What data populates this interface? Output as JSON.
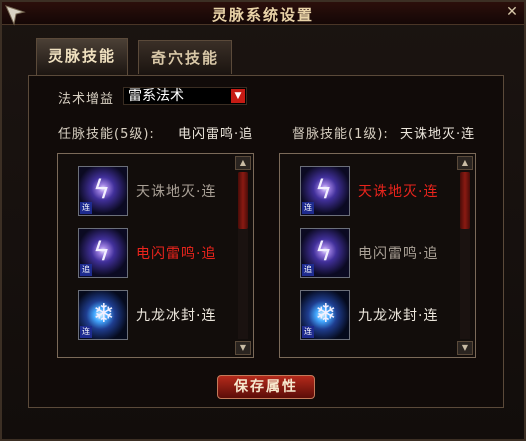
{
  "window": {
    "title": "灵脉系统设置",
    "close_icon": "close-icon"
  },
  "tabs": [
    {
      "label": "灵脉技能",
      "active": true
    },
    {
      "label": "奇穴技能",
      "active": false
    }
  ],
  "spell_boost": {
    "label": "法术增益",
    "selected": "雷系法术"
  },
  "ren_meridian": {
    "label": "任脉技能(5级):",
    "current": "电闪雷鸣·追"
  },
  "du_meridian": {
    "label": "督脉技能(1级):",
    "current": "天诛地灭·连"
  },
  "left_list": [
    {
      "name": "天诛地灭·连",
      "tag": "连",
      "icon": "lightning-skill-icon",
      "state": "dim"
    },
    {
      "name": "电闪雷鸣·追",
      "tag": "追",
      "icon": "lightning-skill-icon",
      "state": "selected"
    },
    {
      "name": "九龙冰封·连",
      "tag": "连",
      "icon": "ice-dragon-skill-icon",
      "state": "normal"
    }
  ],
  "right_list": [
    {
      "name": "天诛地灭·连",
      "tag": "连",
      "icon": "lightning-skill-icon",
      "state": "selected"
    },
    {
      "name": "电闪雷鸣·追",
      "tag": "追",
      "icon": "lightning-skill-icon",
      "state": "dim"
    },
    {
      "name": "九龙冰封·连",
      "tag": "连",
      "icon": "ice-dragon-skill-icon",
      "state": "normal"
    }
  ],
  "save_button": "保存属性",
  "colors": {
    "selected_text": "#e8241c",
    "accent_red": "#c61b14",
    "title_text": "#e9d3a8"
  }
}
